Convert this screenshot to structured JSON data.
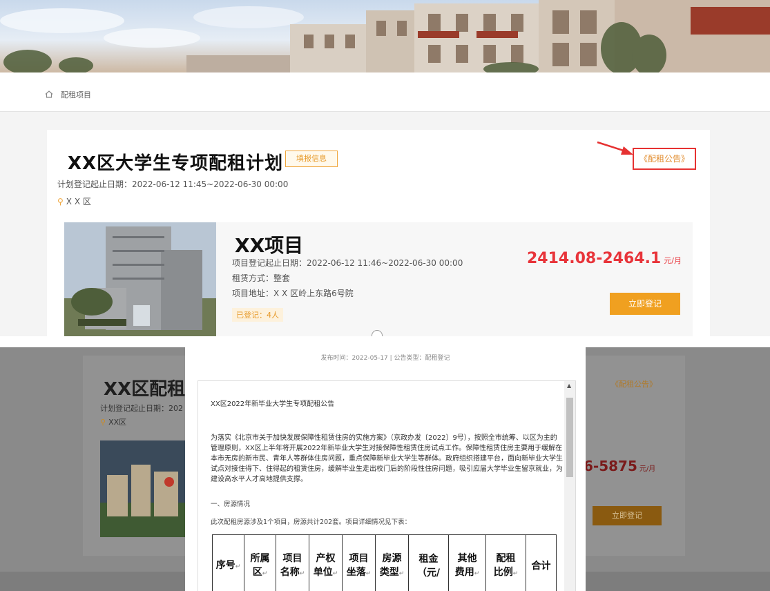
{
  "breadcrumb": {
    "home_icon": "home-icon",
    "label": "配租项目"
  },
  "plan": {
    "title": "XX区大学生专项配租计划",
    "fill_button": "填报信息",
    "dates": "计划登记起止日期：2022-06-12 11:45~2022-06-30 00:00",
    "district": "X X 区",
    "notice_link": "《配租公告》"
  },
  "project": {
    "name": "XX项目",
    "dates": "项目登记起止日期：2022-06-12 11:46~2022-06-30 00:00",
    "rent_type": "租赁方式：整套",
    "address": "项目地址：X X 区岭上东路6号院",
    "registered": "已登记：4人",
    "price": "2414.08-2464.1",
    "price_unit": "元/月",
    "register_button": "立即登记"
  },
  "background": {
    "title": "XX区配租计",
    "dates": "计划登记起止日期：202",
    "district": "XX区",
    "notice_link": "《配租公告》",
    "price": "6-5875",
    "price_unit": "元/月",
    "register_button": "立即登记"
  },
  "modal": {
    "meta": "发布时间：2022-05-17 | 公告类型：配租登记",
    "notice_title": "XX区2022年新毕业大学生专项配租公告",
    "paragraph": "为落实《北京市关于加快发展保障性租赁住房的实施方案》（京政办发〔2022〕9号），按照全市统筹、以区为主的管理原则，XX区上半年将开展2022年新毕业大学生对接保障性租赁住房试点工作。保障性租赁住房主要用于缓解在本市无房的新市民、青年人等群体住房问题，重点保障新毕业大学生等群体。政府组织搭建平台，面向新毕业大学生试点对接住得下、住得起的租赁住房，缓解毕业生走出校门后的阶段性住房问题，吸引应届大学毕业生留京就业，为建设高水平人才高地提供支撑。",
    "section1": "一、房源情况",
    "section1_desc": "此次配租房源涉及1个项目，房源共计202套。项目详细情况见下表：",
    "table_headers": [
      {
        "line1": "序号",
        "line2": ""
      },
      {
        "line1": "所属",
        "line2": "区"
      },
      {
        "line1": "项目",
        "line2": "名称"
      },
      {
        "line1": "产权",
        "line2": "单位"
      },
      {
        "line1": "项目",
        "line2": "坐落"
      },
      {
        "line1": "房源",
        "line2": "类型"
      },
      {
        "line1": "租金",
        "line2": "（元/"
      },
      {
        "line1": "其他",
        "line2": "费用"
      },
      {
        "line1": "配租",
        "line2": "比例"
      },
      {
        "line1": "合计",
        "line2": ""
      }
    ]
  }
}
